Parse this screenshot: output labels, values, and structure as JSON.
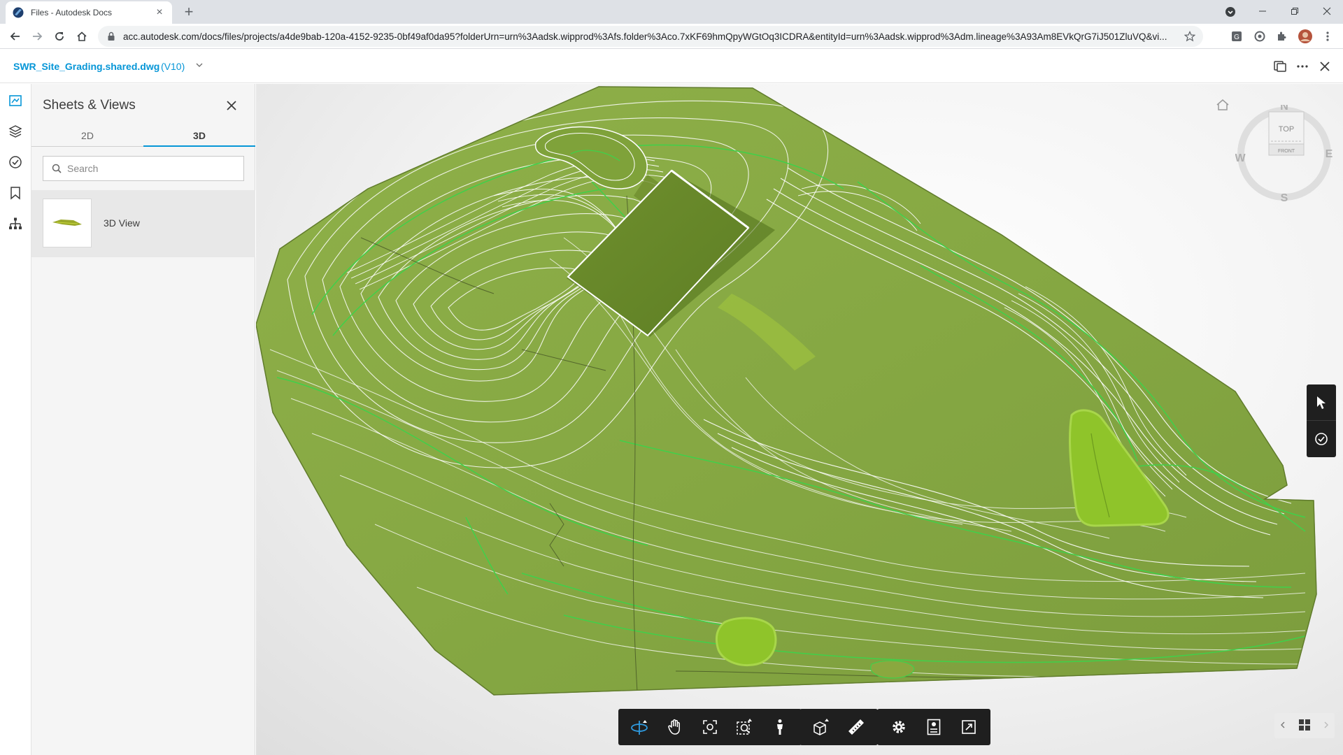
{
  "browser": {
    "tab_title": "Files - Autodesk Docs",
    "url": "acc.autodesk.com/docs/files/projects/a4de9bab-120a-4152-9235-0bf49af0da95?folderUrn=urn%3Aadsk.wipprod%3Afs.folder%3Aco.7xKF69hmQpyWGtOq3ICDRA&entityId=urn%3Aadsk.wipprod%3Adm.lineage%3A93Am8EVkQrG7iJ501ZluVQ&vi..."
  },
  "header": {
    "file_name": "SWR_Site_Grading.shared.dwg",
    "version": "(V10)"
  },
  "panel": {
    "title": "Sheets & Views",
    "tabs": [
      {
        "label": "2D",
        "active": false
      },
      {
        "label": "3D",
        "active": true
      }
    ],
    "search_placeholder": "Search",
    "views": [
      {
        "label": "3D View"
      }
    ]
  },
  "viewcube": {
    "top": "TOP",
    "front": "FRONT",
    "north": "N",
    "south": "S",
    "east": "E",
    "west": "W"
  },
  "colors": {
    "accent": "#0696d7",
    "terrain": "#8fab4a",
    "contour_light": "#ffffff",
    "contour_major": "#3fd14a",
    "toolbar": "#1f1f1f"
  },
  "toolbar_groups": [
    [
      "orbit-icon",
      "pan-icon",
      "fit-to-view-icon",
      "zoom-window-icon",
      "first-person-icon"
    ],
    [
      "explode-model-icon",
      "measure-icon"
    ],
    [
      "settings-icon",
      "properties-icon",
      "fullscreen-icon"
    ]
  ]
}
